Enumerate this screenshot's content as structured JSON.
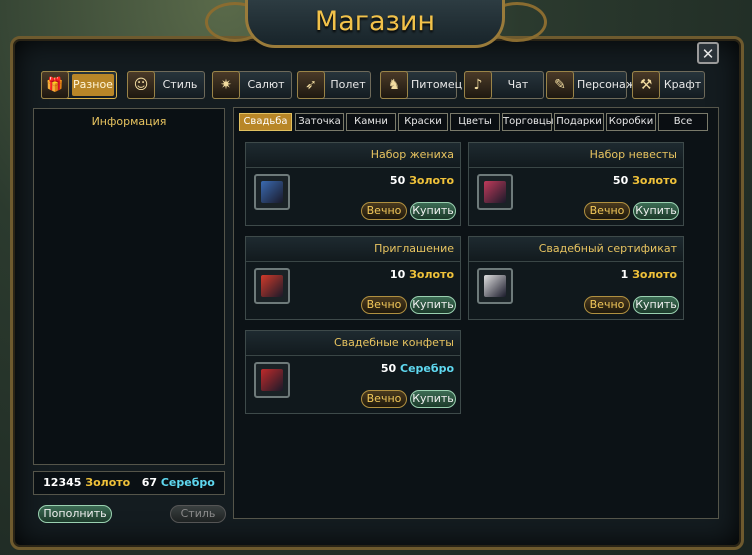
{
  "window": {
    "title": "Магазин",
    "close_label": "✕"
  },
  "categories": [
    {
      "label": "Разное",
      "icon": "gift-icon",
      "glyph": "🎁",
      "active": true
    },
    {
      "label": "Стиль",
      "icon": "character-icon",
      "glyph": "☺",
      "active": false
    },
    {
      "label": "Салют",
      "icon": "firework-icon",
      "glyph": "✷",
      "active": false
    },
    {
      "label": "Полет",
      "icon": "wing-icon",
      "glyph": "➶",
      "active": false
    },
    {
      "label": "Питомец",
      "icon": "horse-icon",
      "glyph": "♞",
      "active": false
    },
    {
      "label": "Чат",
      "icon": "horn-icon",
      "glyph": "♪",
      "active": false
    },
    {
      "label": "Персонаж",
      "icon": "scroll-icon",
      "glyph": "✎",
      "active": false
    },
    {
      "label": "Крафт",
      "icon": "hammer-icon",
      "glyph": "⚒",
      "active": false
    }
  ],
  "info": {
    "title": "Информация"
  },
  "balance": {
    "gold_amount": "12345",
    "gold_label": "Золото",
    "silver_amount": "67",
    "silver_label": "Серебро"
  },
  "buttons": {
    "topup": "Пополнить",
    "style": "Стиль"
  },
  "subtabs": [
    {
      "label": "Свадьба",
      "active": true
    },
    {
      "label": "Заточка",
      "active": false
    },
    {
      "label": "Камни",
      "active": false
    },
    {
      "label": "Краски",
      "active": false
    },
    {
      "label": "Цветы",
      "active": false
    },
    {
      "label": "Торговцы",
      "active": false
    },
    {
      "label": "Подарки",
      "active": false
    },
    {
      "label": "Коробки",
      "active": false
    },
    {
      "label": "Все",
      "active": false
    }
  ],
  "items": [
    {
      "name": "Набор жениха",
      "price_amount": "50",
      "currency": "Золото",
      "currency_color": "#f0c23a",
      "icon": "groom-box-icon",
      "icon_color": "#3a6ab0",
      "duration_label": "Вечно",
      "buy_label": "Купить"
    },
    {
      "name": "Набор невесты",
      "price_amount": "50",
      "currency": "Золото",
      "currency_color": "#f0c23a",
      "icon": "bride-box-icon",
      "icon_color": "#c03a5a",
      "duration_label": "Вечно",
      "buy_label": "Купить"
    },
    {
      "name": "Приглашение",
      "price_amount": "10",
      "currency": "Золото",
      "currency_color": "#f0c23a",
      "icon": "invitation-icon",
      "icon_color": "#d03a2a",
      "duration_label": "Вечно",
      "buy_label": "Купить"
    },
    {
      "name": "Свадебный сертификат",
      "price_amount": "1",
      "currency": "Золото",
      "currency_color": "#f0c23a",
      "icon": "certificate-icon",
      "icon_color": "#e0e0e0",
      "duration_label": "Вечно",
      "buy_label": "Купить"
    },
    {
      "name": "Свадебные конфеты",
      "price_amount": "50",
      "currency": "Серебро",
      "currency_color": "#5fd8f0",
      "icon": "candy-icon",
      "icon_color": "#c02a2a",
      "duration_label": "Вечно",
      "buy_label": "Купить"
    }
  ],
  "colors": {
    "accent": "#b88628",
    "title": "#f2c24a",
    "gold": "#f0c23a",
    "silver": "#5fd8f0"
  }
}
